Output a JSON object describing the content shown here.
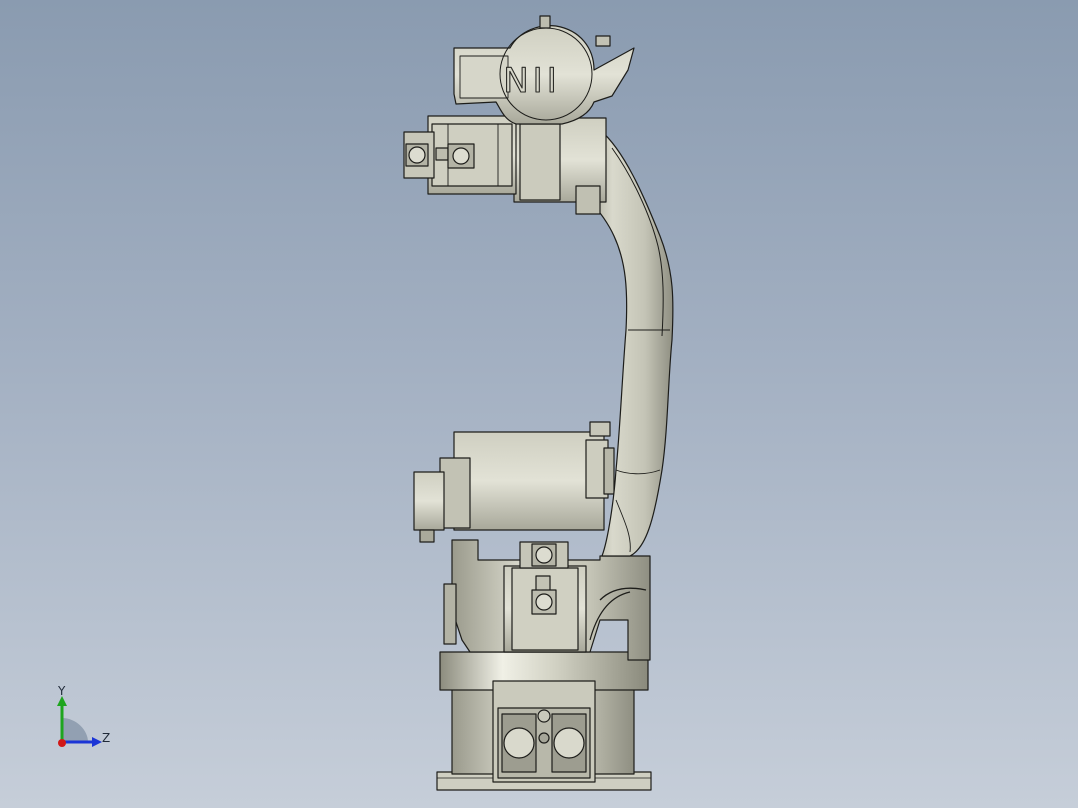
{
  "model": {
    "name": "robot-arm-assembly",
    "emblem_text": "NII"
  },
  "triad": {
    "y_label": "Y",
    "z_label": "Z",
    "colors": {
      "y": "#1ea51e",
      "z": "#1b35d6",
      "x": "#d01818"
    }
  },
  "colors": {
    "background_top": "#8a9bb0",
    "background_bottom": "#c6ced9",
    "metal_light": "#d7d7c9",
    "metal_mid": "#b9b9a9",
    "metal_dark": "#8e8e80",
    "edge": "#1d1d1a"
  }
}
